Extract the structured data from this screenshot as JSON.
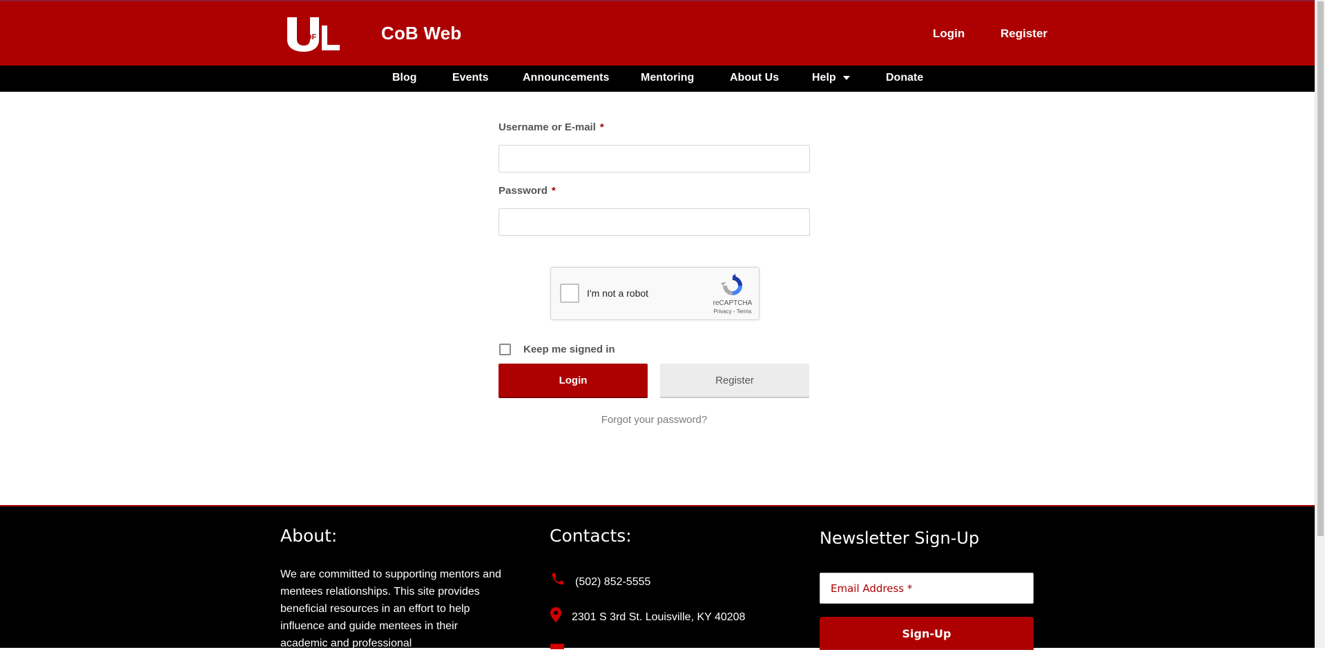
{
  "header": {
    "site_title": "CoB Web",
    "logo_text_main": "UL",
    "logo_text_small": "OF",
    "login_label": "Login",
    "register_label": "Register"
  },
  "nav": {
    "items": [
      "Blog",
      "Events",
      "Announcements",
      "Mentoring",
      "About Us",
      "Help",
      "Donate"
    ]
  },
  "form": {
    "username_label": "Username or E-mail",
    "password_label": "Password",
    "required_mark": "*",
    "username_value": "",
    "password_value": "",
    "captcha_text": "I'm not a robot",
    "captcha_brand": "reCAPTCHA",
    "captcha_terms": "Privacy - Terms",
    "keep_signed_label": "Keep me signed in",
    "login_button": "Login",
    "register_button": "Register",
    "forgot_link": "Forgot your password?"
  },
  "footer": {
    "about_heading": "About:",
    "about_text": "We are committed to supporting mentors and mentees relationships. This site provides beneficial resources in an effort to help influence and guide mentees in their academic and professional",
    "contacts_heading": "Contacts:",
    "phone": "(502) 852-5555",
    "address": "2301 S 3rd St. Louisville, KY 40208",
    "newsletter_heading": "Newsletter Sign-Up",
    "email_placeholder": "Email Address *",
    "signup_button": "Sign-Up"
  },
  "colors": {
    "brand_red": "#ad0000",
    "nav_black": "#000000"
  }
}
